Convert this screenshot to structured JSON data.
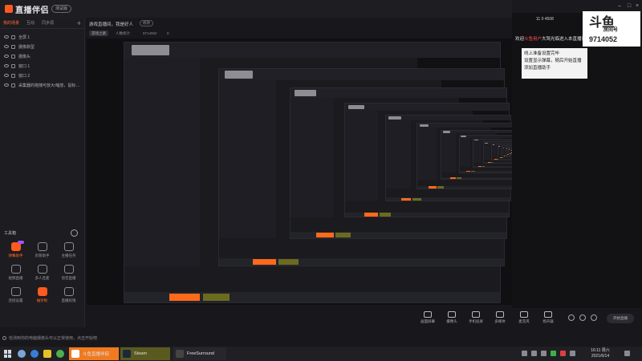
{
  "app": {
    "logo": "直播伴侣",
    "beta": "测试版"
  },
  "left": {
    "tabs": [
      "我的场景",
      "互动",
      "同步源"
    ],
    "add": "+",
    "scenes": [
      "全屏 1",
      "摄像默型",
      "摄像头",
      "窗口 1",
      "窗口 2",
      "采集器的拖拽可放大/缩放，鼠标…"
    ],
    "toolbox_title": "工具箱",
    "tools": [
      {
        "label": "弹幕助手",
        "accent": true
      },
      {
        "label": "房管助手"
      },
      {
        "label": "主播任务"
      },
      {
        "label": "视频直播"
      },
      {
        "label": "多人连麦"
      },
      {
        "label": "语音直播"
      },
      {
        "label": "连招设置"
      },
      {
        "label": "抽奖啦",
        "accent": true
      },
      {
        "label": "直播权限"
      }
    ]
  },
  "center": {
    "stream_title": "游戏直播间，我是好人",
    "edit": "修改",
    "category": "游戏之路",
    "online": "人数统计",
    "room": "9714052",
    "likes": "0"
  },
  "controls": [
    "画面屏幕",
    "摄像头",
    "手机投屏",
    "多媒体",
    "麦克风",
    "扬声器"
  ],
  "start_live": "开始直播",
  "notice": "检测到你的电脑摄像头可以正常使用，点击开始吧",
  "right": {
    "stats": "11  0  4508",
    "brand": "斗鱼",
    "brand_sub": "房间号",
    "room_no": "9714052",
    "chat": [
      {
        "pre": "欢迎",
        "name": "斗鱼用户",
        "post": "大驾光临进入本直播间"
      },
      {
        "pre": "",
        "name": "",
        "post": "线上准备设置完毕"
      },
      {
        "pre": "",
        "name": "",
        "post": "设置显示弹幕，随后开始直播"
      },
      {
        "pre": "",
        "name": "",
        "post": "添加直播助手"
      }
    ]
  },
  "taskbar": {
    "apps": [
      "斗鱼直播伴侣",
      "Steam",
      "FreeSurround"
    ],
    "time": "16:11 周六",
    "date": "2021/6/14"
  }
}
